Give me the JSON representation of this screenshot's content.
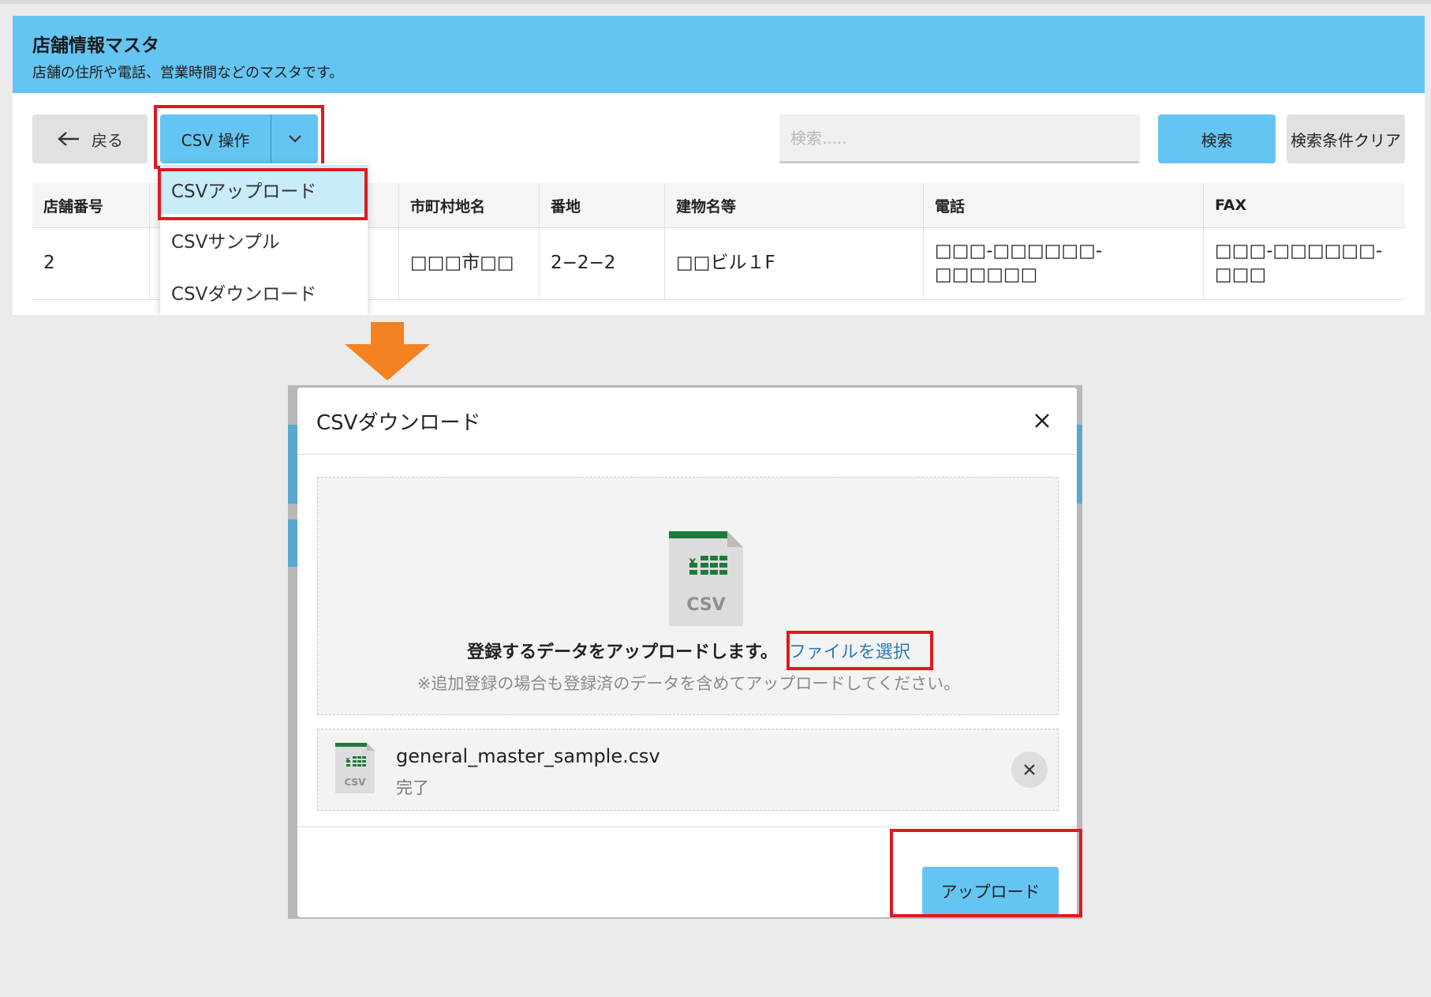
{
  "page": {
    "title": "店舗情報マスタ",
    "subtitle": "店舗の住所や電話、営業時間などのマスタです。"
  },
  "toolbar": {
    "back_label": "戻る",
    "csv_label": "CSV 操作",
    "search_placeholder": "検索.....",
    "search_label": "検索",
    "clear_label": "検索条件クリア"
  },
  "csv_menu": {
    "items": [
      "CSVアップロード",
      "CSVサンプル",
      "CSVダウンロード"
    ]
  },
  "table": {
    "columns": [
      "店舗番号",
      "",
      "市町村地名",
      "番地",
      "建物名等",
      "電話",
      "FAX"
    ],
    "rows": [
      [
        "2",
        "",
        "□□□市□□",
        "2−2−2",
        "□□ビル１F",
        "□□□-□□□□□□-□□□□□□",
        "□□□-□□□□□□-□□□"
      ]
    ]
  },
  "modal": {
    "title": "CSVダウンロード",
    "dropzone_text": "登録するデータをアップロードします。",
    "select_file_link": "ファイルを選択",
    "dropzone_note": "※追加登録の場合も登録済のデータを含めてアップロードしてください。",
    "file_icon_label": "CSV",
    "file": {
      "name": "general_master_sample.csv",
      "status": "完了"
    },
    "upload_label": "アップロード"
  },
  "colors": {
    "accent": "#65c5f2",
    "highlight": "#e0191f",
    "arrow": "#f58220",
    "excel_green": "#1e7a3a"
  },
  "icons": [
    "back-arrow-icon",
    "chevron-down-icon",
    "close-icon",
    "csv-file-icon",
    "down-arrow-icon"
  ]
}
